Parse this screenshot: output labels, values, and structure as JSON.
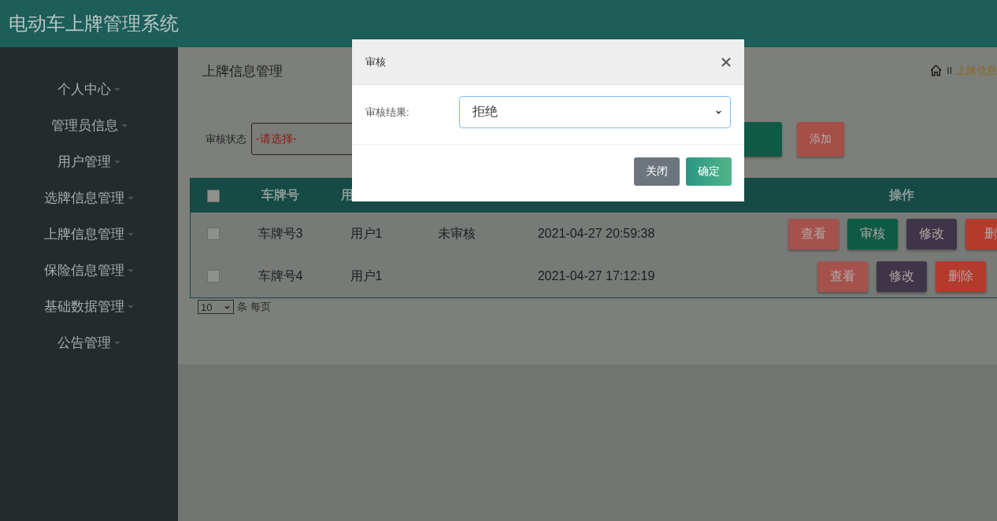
{
  "app_title": "电动车上牌管理系统",
  "sidebar": {
    "items": [
      {
        "label": "个人中心",
        "expanded": false
      },
      {
        "label": "管理员信息",
        "expanded": false
      },
      {
        "label": "用户管理",
        "expanded": false
      },
      {
        "label": "选牌信息管理",
        "expanded": false
      },
      {
        "label": "上牌信息管理",
        "expanded": false
      },
      {
        "label": "保险信息管理",
        "expanded": false
      },
      {
        "label": "基础数据管理",
        "expanded": false
      },
      {
        "label": "公告管理",
        "expanded": false
      }
    ]
  },
  "page_title": "上牌信息管理",
  "breadcrumb": {
    "separator": "II",
    "current": "上牌信息"
  },
  "filter": {
    "label": "审核状态",
    "value": "-请选择-",
    "buttons": [
      {
        "kind": "search"
      },
      {
        "kind": "add",
        "label": "添加"
      }
    ]
  },
  "table": {
    "header_checked": false,
    "columns": [
      "车牌号",
      "用",
      "操作"
    ],
    "rows": [
      {
        "checked": false,
        "cells": [
          "车牌号3",
          "用户1",
          "未审核",
          "2021-04-27 20:59:38"
        ],
        "actions": [
          {
            "kind": "view",
            "label": "查看"
          },
          {
            "kind": "review",
            "label": "审核"
          },
          {
            "kind": "edit",
            "label": "修改"
          },
          {
            "kind": "delete",
            "label": "删"
          }
        ]
      },
      {
        "checked": false,
        "cells": [
          "车牌号4",
          "用户1",
          "",
          "2021-04-27 17:12:19"
        ],
        "actions": [
          {
            "kind": "view",
            "label": "查看"
          },
          {
            "kind": "edit",
            "label": "修改"
          },
          {
            "kind": "delete",
            "label": "删除"
          }
        ]
      }
    ]
  },
  "pagination": {
    "page_size": "10",
    "suffix": "条 每页"
  },
  "modal": {
    "title": "审核",
    "field_label": "审核结果:",
    "field_value": "拒绝",
    "buttons": [
      {
        "kind": "close",
        "label": "关闭"
      },
      {
        "kind": "confirm",
        "label": "确定"
      }
    ]
  }
}
